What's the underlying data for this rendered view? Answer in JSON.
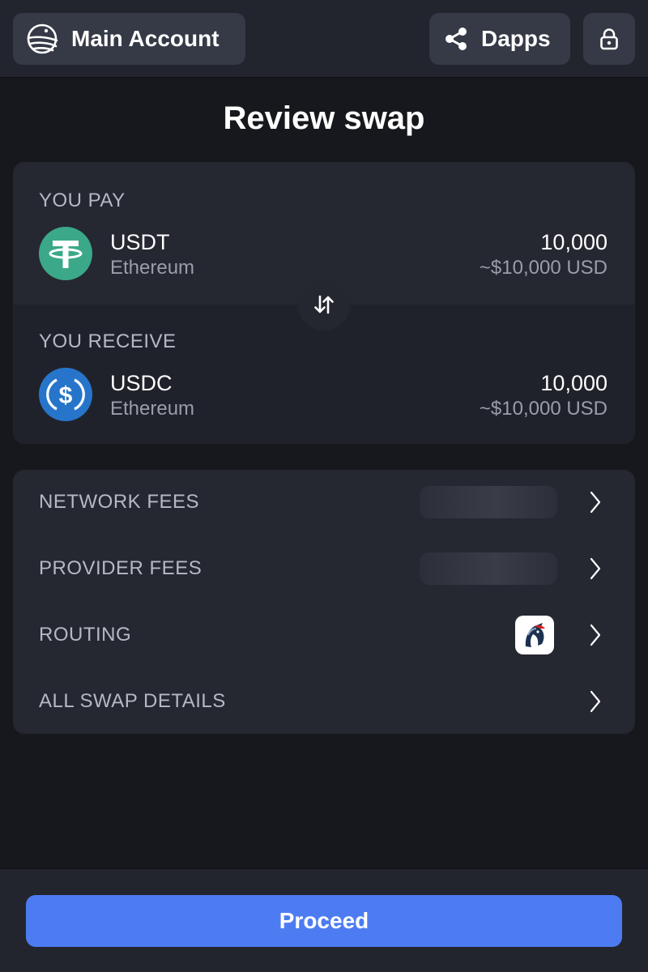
{
  "header": {
    "account_label": "Main Account",
    "dapps_label": "Dapps",
    "account_icon": "logo-icon",
    "dapps_icon": "share-icon",
    "lock_icon": "lock-icon"
  },
  "page": {
    "title": "Review swap"
  },
  "swap": {
    "pay": {
      "label": "YOU PAY",
      "symbol": "USDT",
      "network": "Ethereum",
      "amount": "10,000",
      "usd": "~$10,000 USD",
      "logo_color": "#3ba889"
    },
    "receive": {
      "label": "YOU RECEIVE",
      "symbol": "USDC",
      "network": "Ethereum",
      "amount": "10,000",
      "usd": "~$10,000 USD",
      "logo_color": "#2775ca"
    },
    "switch_icon": "swap-vertical-arrows-icon"
  },
  "details": {
    "network_fees_label": "NETWORK FEES",
    "provider_fees_label": "PROVIDER FEES",
    "routing_label": "ROUTING",
    "all_details_label": "ALL SWAP DETAILS",
    "routing_icon": "1inch-unicorn-icon"
  },
  "footer": {
    "proceed_label": "Proceed"
  },
  "colors": {
    "accent": "#4d7cf2",
    "background": "#17181d",
    "surface": "#252731"
  }
}
